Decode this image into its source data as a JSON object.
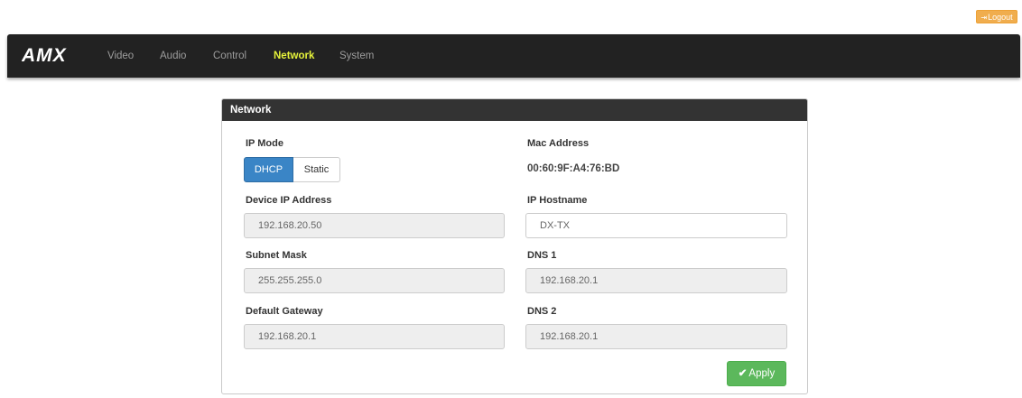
{
  "header": {
    "logout_label": "Logout"
  },
  "navbar": {
    "brand": "AMX",
    "items": [
      {
        "label": "Video",
        "active": false
      },
      {
        "label": "Audio",
        "active": false
      },
      {
        "label": "Control",
        "active": false
      },
      {
        "label": "Network",
        "active": true
      },
      {
        "label": "System",
        "active": false
      }
    ],
    "active_color": "#e5f23a",
    "bar_color": "#222222"
  },
  "panel": {
    "title": "Network",
    "ip_mode": {
      "label": "IP Mode",
      "options": [
        "DHCP",
        "Static"
      ],
      "selected": "DHCP"
    },
    "mac_address": {
      "label": "Mac Address",
      "value": "00:60:9F:A4:76:BD"
    },
    "device_ip": {
      "label": "Device IP Address",
      "value": "192.168.20.50"
    },
    "hostname": {
      "label": "IP Hostname",
      "value": "DX-TX"
    },
    "subnet_mask": {
      "label": "Subnet Mask",
      "value": "255.255.255.0"
    },
    "dns1": {
      "label": "DNS 1",
      "value": "192.168.20.1"
    },
    "gateway": {
      "label": "Default Gateway",
      "value": "192.168.20.1"
    },
    "dns2": {
      "label": "DNS 2",
      "value": "192.168.20.1"
    },
    "apply_label": "Apply",
    "accent_color": "#3a85c6",
    "apply_color": "#5cb85c"
  }
}
